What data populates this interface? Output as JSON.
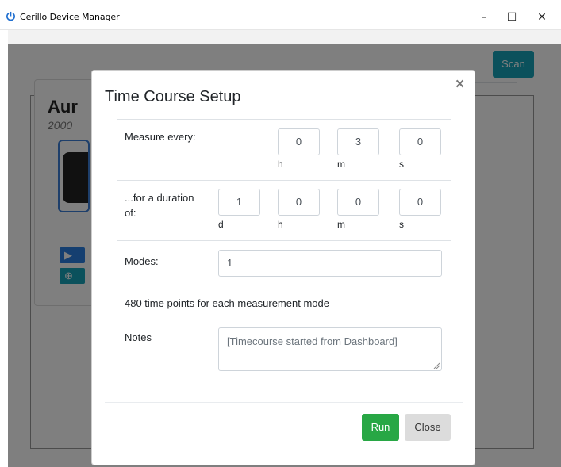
{
  "window": {
    "title": "Cerillo Device Manager",
    "minimize": "–",
    "maximize": "☐",
    "close": "✕",
    "icon": "power-icon"
  },
  "background": {
    "scan_label": "Scan",
    "device_name": "Aur",
    "device_serial": "2000",
    "play_glyph": "▶",
    "target_glyph": "⊕"
  },
  "modal": {
    "title": "Time Course Setup",
    "close_glyph": "×",
    "measure_every": {
      "label": "Measure every:",
      "h": "0",
      "m": "3",
      "s": "0",
      "unit_h": "h",
      "unit_m": "m",
      "unit_s": "s"
    },
    "duration": {
      "label_line1": "...for a duration",
      "label_line2": "of:",
      "d": "1",
      "h": "0",
      "m": "0",
      "s": "0",
      "unit_d": "d",
      "unit_h": "h",
      "unit_m": "m",
      "unit_s": "s"
    },
    "modes": {
      "label": "Modes:",
      "value": "1"
    },
    "time_points_text": "480 time points for each measurement mode",
    "notes": {
      "label": "Notes",
      "value": "[Timecourse started from Dashboard]"
    },
    "run_label": "Run",
    "close_label": "Close"
  },
  "colors": {
    "run": "#28a745",
    "scan": "#17a2b8",
    "close_btn": "#dcdcdc",
    "accent_blue": "#2a7fe0"
  }
}
